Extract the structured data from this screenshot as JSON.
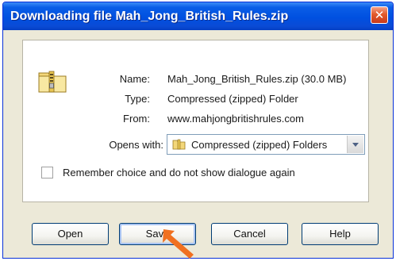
{
  "window": {
    "title": "Downloading file Mah_Jong_British_Rules.zip"
  },
  "file": {
    "name_label": "Name:",
    "name_value": "Mah_Jong_British_Rules.zip (30.0 MB)",
    "type_label": "Type:",
    "type_value": "Compressed (zipped) Folder",
    "from_label": "From:",
    "from_value": "www.mahjongbritishrules.com"
  },
  "opens_with": {
    "label": "Opens with:",
    "value": "Compressed (zipped) Folders"
  },
  "remember": {
    "label": "Remember choice and do not show dialogue again",
    "checked": false
  },
  "buttons": {
    "open": "Open",
    "save": "Save",
    "cancel": "Cancel",
    "help": "Help"
  },
  "colors": {
    "titlebar": "#0050e0",
    "dialog_bg": "#ece9d8",
    "close": "#e25a2b",
    "arrow": "#f07020"
  },
  "icons": [
    "zip-folder-icon",
    "folder-icon",
    "chevron-down-icon",
    "close-icon",
    "pointer-arrow-icon"
  ]
}
